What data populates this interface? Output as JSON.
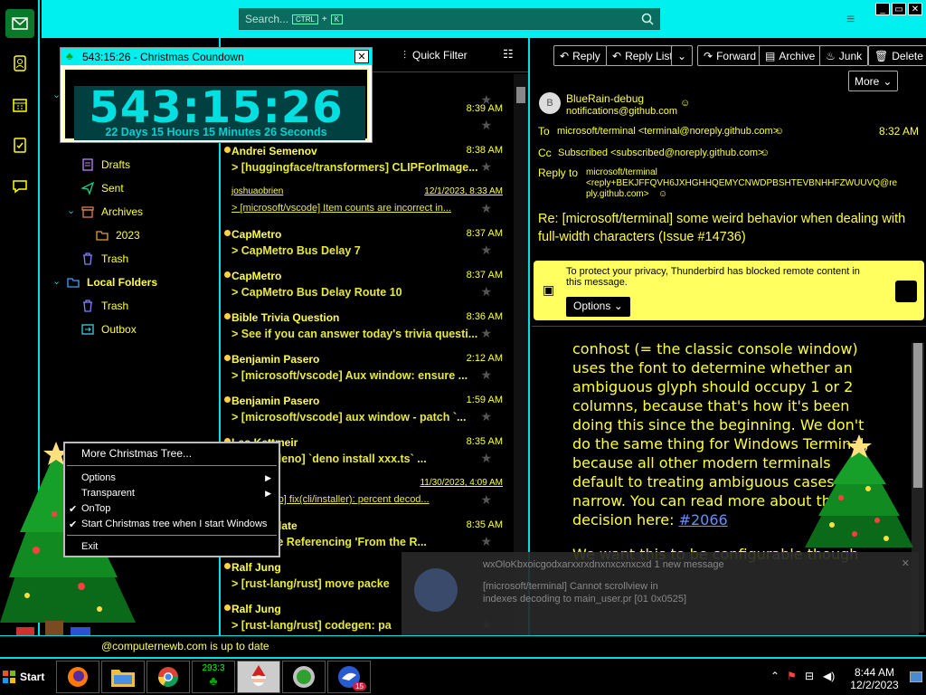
{
  "search": {
    "placeholder": "Search...",
    "shortcut_ctrl": "CTRL",
    "shortcut_plus": "+",
    "shortcut_key": "K"
  },
  "window": {
    "minimize": "_",
    "maximize": "▭",
    "close": "✕"
  },
  "folders": {
    "items": [
      {
        "label": "Drafts"
      },
      {
        "label": "Sent"
      },
      {
        "label": "Archives"
      },
      {
        "label": "2023"
      },
      {
        "label": "Trash"
      },
      {
        "label": "Local Folders"
      },
      {
        "label": "Trash"
      },
      {
        "label": "Outbox"
      }
    ]
  },
  "list": {
    "quick_filter": "Quick Filter",
    "messages": [
      {
        "sender": "",
        "subject": "ee sync (PR #11850...",
        "time": ""
      },
      {
        "sender": "",
        "subject": "to have your gift ...",
        "time": "8:39 AM"
      },
      {
        "sender": "Andrei Semenov",
        "subject": "[huggingface/transformers] CLIPForImage...",
        "time": "8:38 AM"
      },
      {
        "sender": "joshuaobrien",
        "subject": "[microsoft/vscode] Item counts are incorrect in...",
        "time": "12/1/2023, 8:33 AM"
      },
      {
        "sender": "CapMetro",
        "subject": "CapMetro Bus Delay 7",
        "time": "8:37 AM"
      },
      {
        "sender": "CapMetro",
        "subject": "CapMetro Bus Delay Route 10",
        "time": "8:37 AM"
      },
      {
        "sender": "Bible Trivia Question",
        "subject": "See if you can answer today's trivia questi...",
        "time": "8:36 AM"
      },
      {
        "sender": "Benjamin Pasero",
        "subject": "[microsoft/vscode] Aux window: ensure ...",
        "time": "2:12 AM"
      },
      {
        "sender": "Benjamin Pasero",
        "subject": "[microsoft/vscode] aux window - patch `...",
        "time": "1:59 AM"
      },
      {
        "sender": "Leo Kettmeir",
        "subject": "oland/deno] `deno install xxx.ts` ...",
        "time": "8:35 AM"
      },
      {
        "sender": "ir",
        "subject": "land/deno] fix(cli/installer): percent decod...",
        "time": "11/30/2023, 4:09 AM"
      },
      {
        "sender": "Daily Update",
        "subject": "alestine Referencing 'From the R...",
        "time": "8:35 AM"
      },
      {
        "sender": "Ralf Jung",
        "subject": "[rust-lang/rust] move packe",
        "time": ""
      },
      {
        "sender": "Ralf Jung",
        "subject": "[rust-lang/rust] codegen: pa",
        "time": ""
      }
    ]
  },
  "reader": {
    "buttons": {
      "reply": "Reply",
      "reply_list": "Reply List",
      "forward": "Forward",
      "archive": "Archive",
      "junk": "Junk",
      "delete": "Delete",
      "more": "More"
    },
    "from_name": "BlueRain-debug",
    "from_email": "notifications@github.com",
    "avatar_letter": "B",
    "to_label": "To",
    "to_value": "microsoft/terminal <terminal@noreply.github.com>",
    "time": "8:32 AM",
    "cc_label": "Cc",
    "cc_value": "Subscribed <subscribed@noreply.github.com>",
    "replyto_label": "Reply to",
    "replyto_line1": "microsoft/terminal",
    "replyto_line2": "<reply+BEKJFFQVH6JXHGHHQEMYCNWDPBSHTEVBNHHFZWUUVQ@re",
    "replyto_line3": "ply.github.com>",
    "subject": "Re: [microsoft/terminal] some weird behavior when dealing with full-width characters (Issue #14736)",
    "privacy_text": "To protect your privacy, Thunderbird has blocked remote content in this message.",
    "privacy_button": "Options",
    "body_p1": "conhost (= the classic console window) uses the font to determine whether an ambiguous glyph should occupy 1 or 2 columns, because that's how it's been doing this since the beginning. We don't do the same thing for Windows Terminal, because all other modern terminals default to treating ambiguous cases as narrow. You can read more about this decision here: ",
    "body_link": "#2066",
    "body_p2": "We want this to be configurable though"
  },
  "status": {
    "text": "@computernewb.com is up to date"
  },
  "toast": {
    "line1": "wxOloKbxoicgodxarxxrxdnxnxcxnxcxd 1 new message",
    "line2": "[microsoft/terminal] Cannot scrollview in",
    "line3": "indexes decoding to main_user.pr [01 0x0525]"
  },
  "countdown": {
    "title": "543:15:26 - Christmas Coundown",
    "big": "543:15:26",
    "small": "22 Days 15 Hours 15 Minutes 26 Seconds",
    "close": "✕"
  },
  "context_menu": {
    "header": "More Christmas Tree...",
    "options": "Options",
    "transparent": "Transparent",
    "ontop": "OnTop",
    "start_with_windows": "Start Christmas tree when I start Windows",
    "exit": "Exit"
  },
  "taskbar": {
    "start": "Start",
    "countdown_badge": "293:3",
    "thunderbird_badge": "15",
    "clock_time": "8:44 AM",
    "clock_date": "12/2/2023"
  },
  "colors": {
    "accent": "#00f0f0",
    "text": "#ffff40",
    "link": "#6a8cff",
    "notice": "#ffff60"
  }
}
